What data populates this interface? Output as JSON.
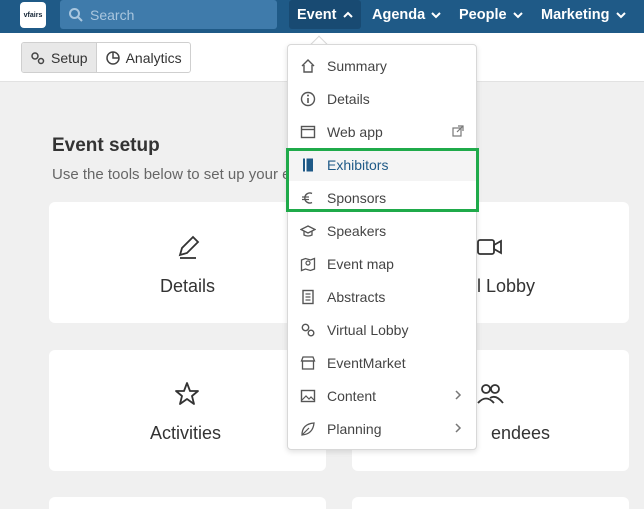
{
  "topbar": {
    "logo_text": "vfairs",
    "search_placeholder": "Search",
    "nav": [
      {
        "label": "Event"
      },
      {
        "label": "Agenda"
      },
      {
        "label": "People"
      },
      {
        "label": "Marketing"
      }
    ]
  },
  "subbar": {
    "setup_label": "Setup",
    "analytics_label": "Analytics"
  },
  "main": {
    "title": "Event setup",
    "subtitle": "Use the tools below to set up your event",
    "cards": [
      {
        "label": "Details",
        "icon": "pencil-icon"
      },
      {
        "label": "al Lobby",
        "icon": "video-gear-icon"
      },
      {
        "label": "Activities",
        "icon": "star-icon"
      },
      {
        "label": "endees",
        "icon": "people-icon"
      }
    ]
  },
  "menu": {
    "items": [
      {
        "label": "Summary",
        "icon": "home-icon"
      },
      {
        "label": "Details",
        "icon": "info-icon"
      },
      {
        "label": "Web app",
        "icon": "window-icon"
      },
      {
        "label": "Exhibitors",
        "icon": "book-icon"
      },
      {
        "label": "Sponsors",
        "icon": "euro-icon"
      },
      {
        "label": "Speakers",
        "icon": "graduation-cap-icon"
      },
      {
        "label": "Event map",
        "icon": "map-icon"
      },
      {
        "label": "Abstracts",
        "icon": "document-icon"
      },
      {
        "label": "Virtual Lobby",
        "icon": "gears-icon"
      },
      {
        "label": "EventMarket",
        "icon": "store-icon"
      },
      {
        "label": "Content",
        "icon": "image-icon"
      },
      {
        "label": "Planning",
        "icon": "leaf-icon"
      }
    ]
  },
  "colors": {
    "topbar": "#1f5a87",
    "highlight": "#1faa4a",
    "selected_text": "#1f5a87"
  }
}
